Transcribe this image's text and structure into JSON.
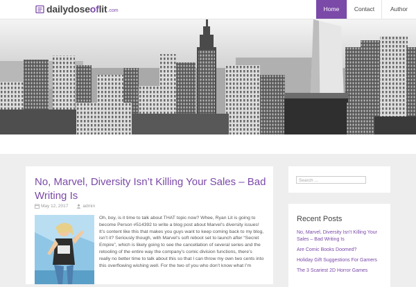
{
  "header": {
    "logo_main": "dailydose",
    "logo_accent": "of",
    "logo_tail": "lit",
    "logo_domain": ".com",
    "nav": [
      {
        "label": "Home"
      },
      {
        "label": "Contact"
      },
      {
        "label": "Author"
      }
    ]
  },
  "post": {
    "title": "No, Marvel, Diversity Isn’t Killing Your Sales – Bad Writing Is",
    "date": "May 12, 2017",
    "author": "admin",
    "excerpt": "Oh, boy, is it time to talk about THAT topic now? Whee, Ryan Lit is going to become Person #514392 to write a blog post about Marvel’s diversity issues! It’s content like this that makes you guys want to keep coming back to my blog, isn’t it? Seriously though, with Marvel’s soft reboot set to launch after “Secret Empire”, which is likely going to see the cancellation of several series and the retooling of the entire way the company’s comic division functions, there’s really no better time to talk about this so that I can throw my own two cents into this overflowing wishing well. For the two of you who don’t know what I’m"
  },
  "sidebar": {
    "search_placeholder": "Search ...",
    "recent_title": "Recent Posts",
    "recent_posts": [
      "No, Marvel, Diversity Isn’t Killing Your Sales – Bad Writing Is",
      "Are Comic Books Doomed?",
      "Holiday Gift Suggestions For Gamers",
      "The 3 Scariest 2D Horror Games"
    ]
  },
  "colors": {
    "accent": "#7b49a8"
  }
}
